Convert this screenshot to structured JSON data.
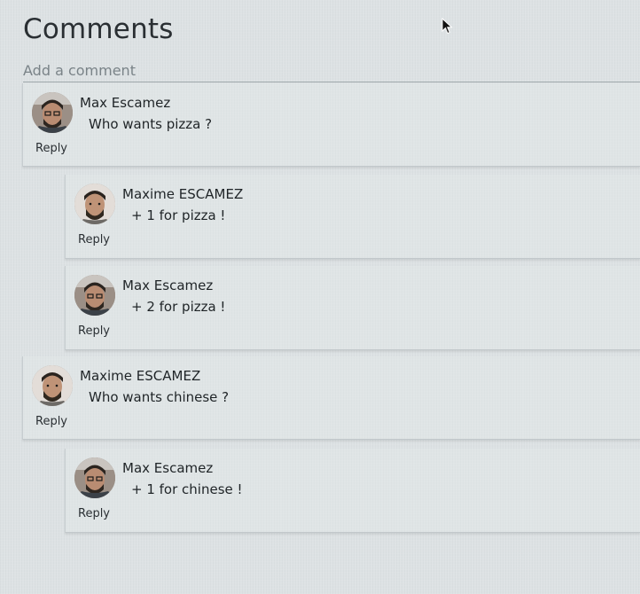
{
  "header": {
    "title": "Comments"
  },
  "composer": {
    "placeholder": "Add a comment"
  },
  "comments": [
    {
      "author": "Max Escamez",
      "text": "Who wants pizza ?",
      "reply_label": "Reply",
      "avatar_icon": "user-avatar-icon"
    },
    {
      "author": "Maxime ESCAMEZ",
      "text": "+ 1 for pizza !",
      "reply_label": "Reply",
      "avatar_icon": "user-avatar-icon"
    },
    {
      "author": "Max Escamez",
      "text": "+ 2 for pizza !",
      "reply_label": "Reply",
      "avatar_icon": "user-avatar-icon"
    },
    {
      "author": "Maxime ESCAMEZ",
      "text": "Who wants chinese ?",
      "reply_label": "Reply",
      "avatar_icon": "user-avatar-icon"
    },
    {
      "author": "Max Escamez",
      "text": "+ 1 for chinese !",
      "reply_label": "Reply",
      "avatar_icon": "user-avatar-icon"
    }
  ],
  "colors": {
    "background": "#dde2e4",
    "text": "#2a2f33",
    "placeholder": "#7a8388"
  }
}
